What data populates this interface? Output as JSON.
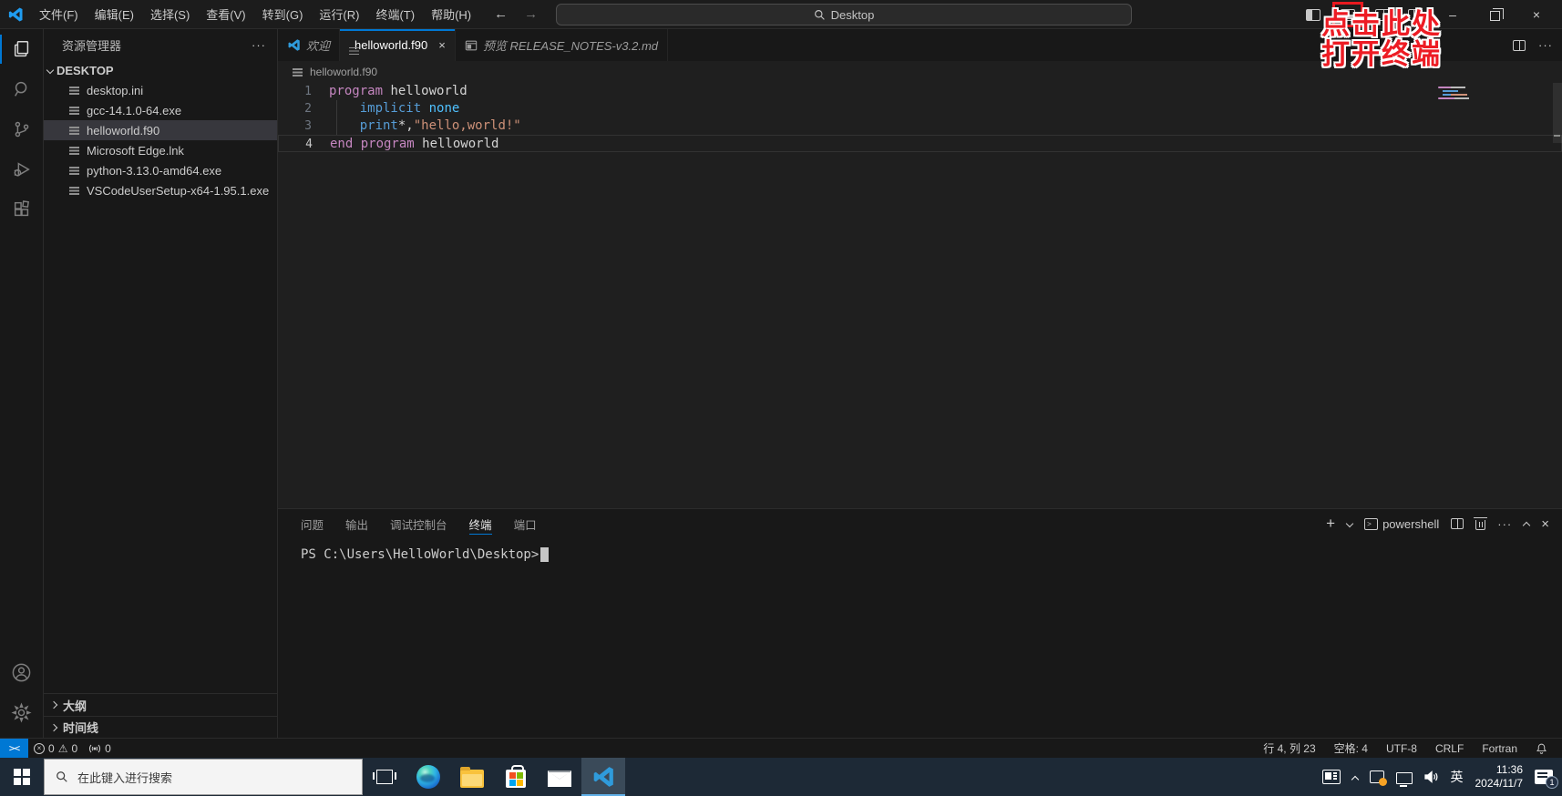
{
  "titlebar": {
    "menus": [
      "文件(F)",
      "编辑(E)",
      "选择(S)",
      "查看(V)",
      "转到(G)",
      "运行(R)",
      "终端(T)",
      "帮助(H)"
    ],
    "search_placeholder": "Desktop",
    "back_arrow": "←",
    "forward_arrow": "→"
  },
  "annotation": {
    "line1": "点击此处",
    "line2": "打开终端"
  },
  "activity_bar": {
    "items": [
      "explorer",
      "search",
      "source-control",
      "run-debug",
      "extensions"
    ],
    "active": "explorer"
  },
  "sidebar": {
    "title": "资源管理器",
    "more_label": "···",
    "root": "DESKTOP",
    "files": [
      "desktop.ini",
      "gcc-14.1.0-64.exe",
      "helloworld.f90",
      "Microsoft Edge.lnk",
      "python-3.13.0-amd64.exe",
      "VSCodeUserSetup-x64-1.95.1.exe"
    ],
    "selected_index": 2,
    "bottom_sections": [
      "大纲",
      "时间线"
    ]
  },
  "editor": {
    "tabs": [
      {
        "label": "欢迎",
        "icon": "vscode",
        "italic": true,
        "active": false,
        "closable": false
      },
      {
        "label": "helloworld.f90",
        "icon": "file",
        "italic": false,
        "active": true,
        "closable": true
      },
      {
        "label": "预览 RELEASE_NOTES-v3.2.md",
        "icon": "preview",
        "italic": true,
        "active": false,
        "closable": false
      }
    ],
    "close_glyph": "×",
    "more_label": "···",
    "breadcrumb": "helloworld.f90",
    "lines": [
      {
        "n": "1",
        "current": false,
        "tokens": [
          [
            "program ",
            "kw"
          ],
          [
            "helloworld",
            "pl"
          ]
        ]
      },
      {
        "n": "2",
        "current": false,
        "tokens": [
          [
            "    ",
            "pl"
          ],
          [
            "implicit",
            "b1"
          ],
          [
            " ",
            "pl"
          ],
          [
            "none",
            "b2"
          ]
        ]
      },
      {
        "n": "3",
        "current": false,
        "tokens": [
          [
            "    ",
            "pl"
          ],
          [
            "print",
            "b1"
          ],
          [
            "*,",
            "pl"
          ],
          [
            "\"hello,world!\"",
            "st"
          ]
        ]
      },
      {
        "n": "4",
        "current": true,
        "tokens": [
          [
            "end program",
            "kw"
          ],
          [
            " helloworld",
            "pl"
          ]
        ]
      }
    ]
  },
  "panel": {
    "tabs": [
      "问题",
      "输出",
      "调试控制台",
      "终端",
      "端口"
    ],
    "active_tab": "终端",
    "new_terminal_label": "+",
    "shell_label": "powershell",
    "more_label": "···",
    "close_glyph": "×",
    "prompt": "PS C:\\Users\\HelloWorld\\Desktop>"
  },
  "statusbar": {
    "remote_glyph": "><",
    "errors": "0",
    "warnings": "0",
    "broadcast_count": "0",
    "line_col": "行 4, 列 23",
    "indent": "空格: 4",
    "encoding": "UTF-8",
    "eol": "CRLF",
    "language": "Fortran"
  },
  "taskbar": {
    "search_placeholder": "在此键入进行搜索",
    "ime": "英",
    "time": "11:36",
    "date": "2024/11/7",
    "notification_count": "1"
  },
  "colors": {
    "accent": "#0078d4",
    "annotation_red": "#ed1c24",
    "selection_bg": "#37373d"
  }
}
